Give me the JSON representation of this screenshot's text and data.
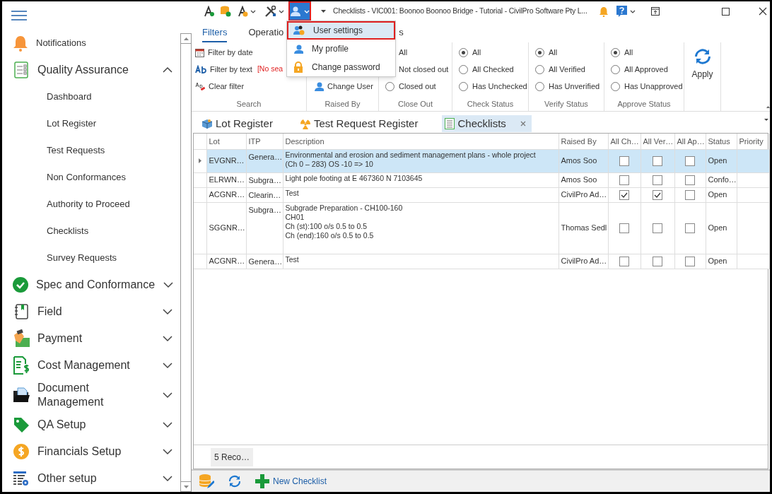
{
  "title_bar": {
    "title": "Checklists - VIC001: Boonoo Boonoo Bridge - Tutorial - CivilPro Software Pty L..."
  },
  "user_menu": {
    "expanded": true,
    "items": [
      {
        "label": "User settings",
        "selected": true
      },
      {
        "label": "My profile",
        "selected": false
      },
      {
        "label": "Change password",
        "selected": false
      }
    ]
  },
  "sidebar": {
    "items": [
      {
        "label": "Notifications",
        "kind": "link"
      },
      {
        "label": "Quality Assurance",
        "kind": "section",
        "expanded": true,
        "children": [
          {
            "label": "Dashboard"
          },
          {
            "label": "Lot Register"
          },
          {
            "label": "Test Requests"
          },
          {
            "label": "Non Conformances"
          },
          {
            "label": "Authority to Proceed"
          },
          {
            "label": "Checklists"
          },
          {
            "label": "Survey Requests"
          }
        ]
      },
      {
        "label": "Spec and Conformance",
        "kind": "section",
        "expanded": false
      },
      {
        "label": "Field",
        "kind": "section",
        "expanded": false
      },
      {
        "label": "Payment",
        "kind": "section",
        "expanded": false
      },
      {
        "label": "Cost Management",
        "kind": "section",
        "expanded": false
      },
      {
        "label": "Document Management",
        "kind": "section",
        "expanded": false
      },
      {
        "label": "QA Setup",
        "kind": "section",
        "expanded": false
      },
      {
        "label": "Financials Setup",
        "kind": "section",
        "expanded": false
      },
      {
        "label": "Other setup",
        "kind": "section",
        "expanded": false
      }
    ]
  },
  "ribbon": {
    "tabs": [
      {
        "label": "Filters",
        "selected": true
      },
      {
        "label": "Operatio",
        "selected": false
      },
      {
        "label": "s",
        "selected": false
      }
    ],
    "groups": [
      {
        "title": "Search",
        "kind": "commands",
        "items": [
          {
            "label": "Filter by date"
          },
          {
            "label": "Filter by text",
            "note": "[No sea"
          },
          {
            "label": "Clear filter"
          }
        ]
      },
      {
        "title": "Raised By",
        "kind": "commands",
        "items": [
          {
            "label": "Change User"
          }
        ]
      },
      {
        "title": "Close Out",
        "kind": "radios",
        "options": [
          {
            "label": "All"
          },
          {
            "label": "Not closed out"
          },
          {
            "label": "Closed out",
            "selected": false
          }
        ]
      },
      {
        "title": "Check Status",
        "kind": "radios",
        "options": [
          {
            "label": "All",
            "selected": true
          },
          {
            "label": "All Checked",
            "selected": false
          },
          {
            "label": "Has Unchecked",
            "selected": false
          }
        ]
      },
      {
        "title": "Verify Status",
        "kind": "radios",
        "options": [
          {
            "label": "All",
            "selected": true
          },
          {
            "label": "All Verified",
            "selected": false
          },
          {
            "label": "Has Unverified",
            "selected": false
          }
        ]
      },
      {
        "title": "Approve Status",
        "kind": "radios",
        "options": [
          {
            "label": "All",
            "selected": true
          },
          {
            "label": "All Approved",
            "selected": false
          },
          {
            "label": "Has Unapproved",
            "selected": false
          }
        ]
      }
    ],
    "apply": "Apply"
  },
  "doc_tabs": [
    {
      "label": "Lot Register",
      "selected": false
    },
    {
      "label": "Test Request Register",
      "selected": false
    },
    {
      "label": "Checklists",
      "selected": true
    }
  ],
  "grid": {
    "columns": [
      "Lot",
      "ITP",
      "Description",
      "Raised By",
      "All Ch…",
      "All Ver…",
      "All Ap…",
      "Status",
      "Priority"
    ],
    "rows": [
      {
        "lot": "EVGNR…",
        "itp": "Genera…",
        "description": "Environmental and erosion and sediment management plans - whole project\n(Ch 0 – 283) OS -10 => 10",
        "raised_by": "Amos Soo",
        "all_checked": false,
        "all_verified": false,
        "all_approved": false,
        "status": "Open",
        "selected": true
      },
      {
        "lot": "ELRWN…",
        "itp": "Subgra…",
        "description": "Light pole footing at E 467360 N 7103645",
        "raised_by": "Amos Soo",
        "all_checked": false,
        "all_verified": false,
        "all_approved": false,
        "status": "Confo…",
        "selected": false
      },
      {
        "lot": "ACGNR…",
        "itp": "Clearin…",
        "description": "Test",
        "raised_by": "CivilPro Ad…",
        "all_checked": true,
        "all_verified": true,
        "all_approved": false,
        "status": "Open",
        "selected": false
      },
      {
        "lot": "SGGNR…",
        "itp": "Subgra…",
        "description": "Subgrade Preparation - CH100-160\nCH01\nCh (st):100 o/s 0.5 to 0.5\nCh (end):160 o/s 0.5 to 0.5",
        "raised_by": "Thomas Sedl",
        "all_checked": false,
        "all_verified": false,
        "all_approved": false,
        "status": "Open",
        "selected": false
      },
      {
        "lot": "ACGNR…",
        "itp": "Genera…",
        "description": "Test",
        "raised_by": "CivilPro Ad…",
        "all_checked": false,
        "all_verified": false,
        "all_approved": false,
        "status": "Open",
        "selected": false
      }
    ],
    "record_count": "5 Reco…"
  },
  "bottom_toolbar": {
    "new_button": "New Checklist"
  }
}
